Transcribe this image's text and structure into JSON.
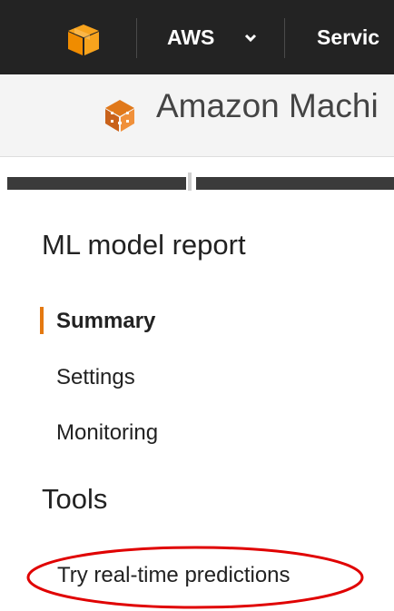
{
  "topbar": {
    "logo_icon": "aws-box-icon",
    "aws_menu_label": "AWS",
    "services_label": "Servic",
    "chevron_icon": "chevron-down-icon"
  },
  "service_header": {
    "icon": "amazon-ml-icon",
    "title": "Amazon Machi"
  },
  "sidebar": {
    "report_title": "ML model report",
    "items": [
      {
        "label": "Summary",
        "active": true
      },
      {
        "label": "Settings",
        "active": false
      },
      {
        "label": "Monitoring",
        "active": false
      }
    ],
    "tools_title": "Tools",
    "tools": [
      {
        "label": "Try real-time predictions",
        "highlighted": true
      }
    ]
  },
  "colors": {
    "topbar_bg": "#232323",
    "active_accent": "#e47911",
    "highlight_ellipse": "#e00000"
  }
}
